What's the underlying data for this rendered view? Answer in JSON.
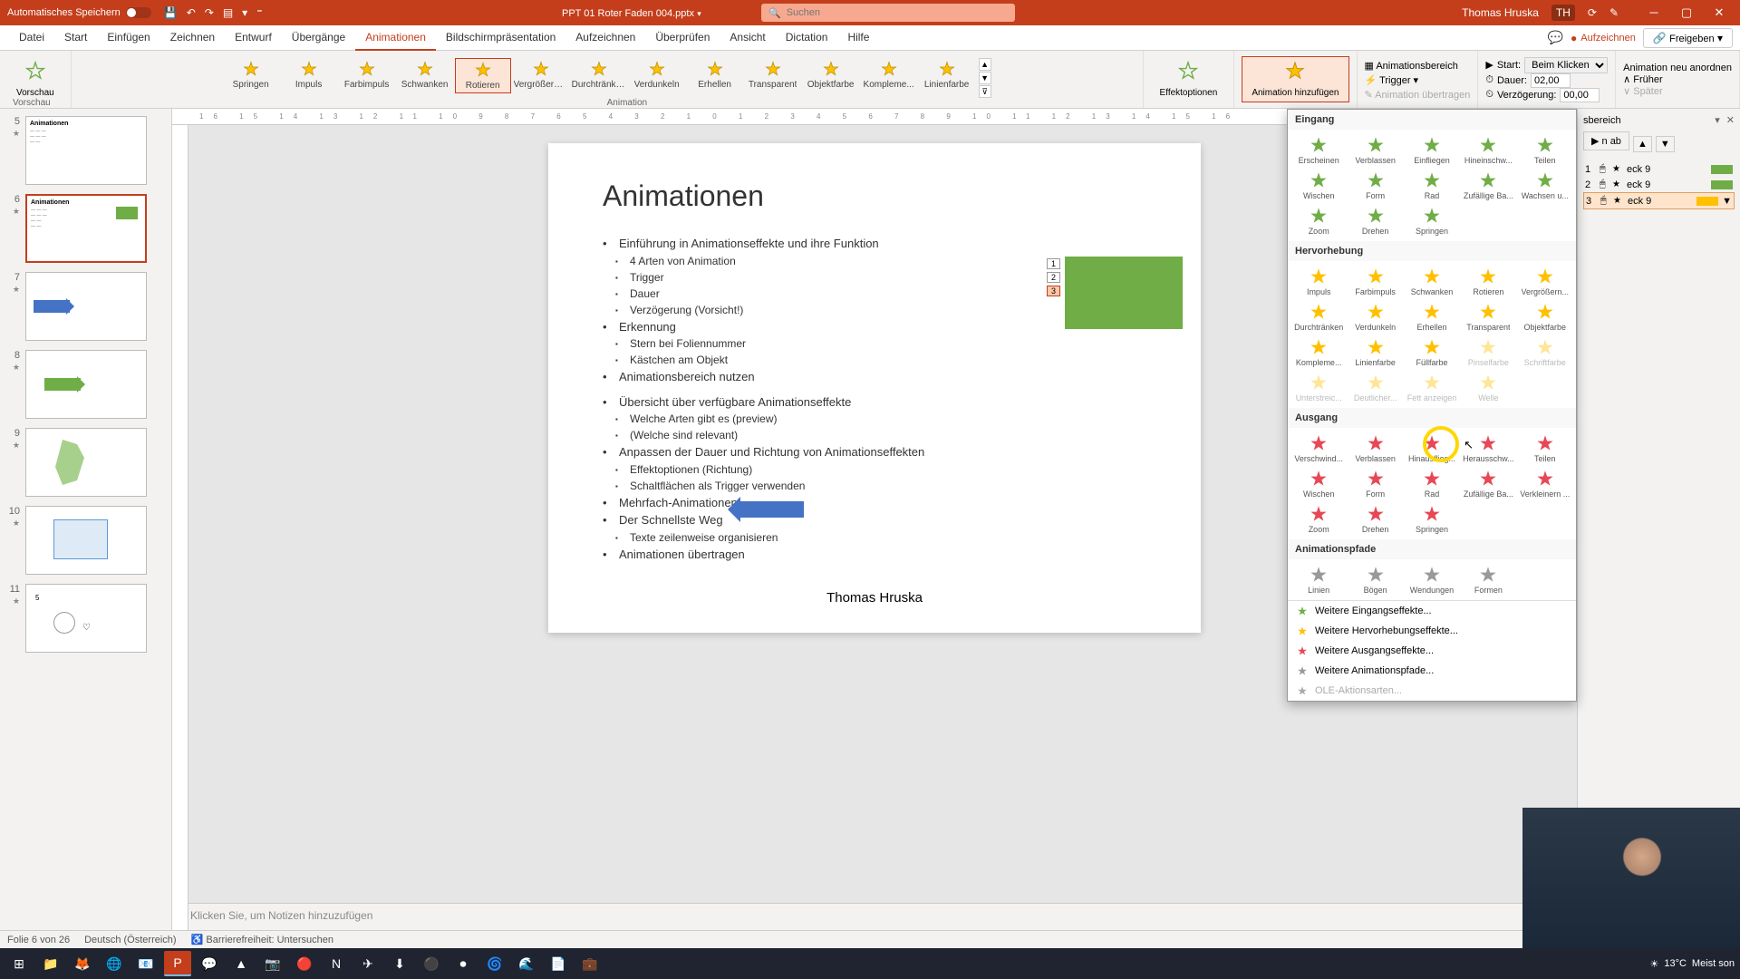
{
  "titlebar": {
    "autosave": "Automatisches Speichern",
    "filename": "PPT 01 Roter Faden 004.pptx",
    "search_placeholder": "Suchen",
    "username": "Thomas Hruska",
    "user_initials": "TH"
  },
  "menubar": {
    "tabs": [
      "Datei",
      "Start",
      "Einfügen",
      "Zeichnen",
      "Entwurf",
      "Übergänge",
      "Animationen",
      "Bildschirmpräsentation",
      "Aufzeichnen",
      "Überprüfen",
      "Ansicht",
      "Dictation",
      "Hilfe"
    ],
    "active": "Animationen",
    "record": "Aufzeichnen",
    "share": "Freigeben"
  },
  "ribbon": {
    "preview_label": "Vorschau",
    "preview_group": "Vorschau",
    "gallery": [
      "Springen",
      "Impuls",
      "Farbimpuls",
      "Schwanken",
      "Rotieren",
      "Vergrößern/...",
      "Durchtränken",
      "Verdunkeln",
      "Erhellen",
      "Transparent",
      "Objektfarbe",
      "Kompleme...",
      "Linienfarbe"
    ],
    "gallery_selected": "Rotieren",
    "animation_group": "Animation",
    "effect_options": "Effektoptionen",
    "add_animation": "Animation hinzufügen",
    "anim_pane": "Animationsbereich",
    "trigger": "Trigger",
    "anim_painter": "Animation übertragen",
    "start_label": "Start:",
    "start_value": "Beim Klicken",
    "duration_label": "Dauer:",
    "duration_value": "02,00",
    "delay_label": "Verzögerung:",
    "delay_value": "00,00",
    "reorder": "Animation neu anordnen",
    "earlier": "Früher",
    "later": "Später"
  },
  "thumbs": [
    {
      "num": "5",
      "title": "Animationen"
    },
    {
      "num": "6",
      "title": "Animationen",
      "active": true
    },
    {
      "num": "7",
      "title": ""
    },
    {
      "num": "8",
      "title": ""
    },
    {
      "num": "9",
      "title": ""
    },
    {
      "num": "10",
      "title": ""
    },
    {
      "num": "11",
      "title": ""
    }
  ],
  "slide": {
    "title": "Animationen",
    "bullets": [
      {
        "t": "Einführung in Animationseffekte und ihre Funktion",
        "sub": [
          "4 Arten von Animation",
          "Trigger",
          "Dauer",
          "Verzögerung (Vorsicht!)"
        ]
      },
      {
        "t": "Erkennung",
        "sub": [
          "Stern bei Foliennummer",
          "Kästchen am Objekt"
        ]
      },
      {
        "t": "Animationsbereich nutzen",
        "sub": []
      },
      {
        "t": "",
        "sub": []
      },
      {
        "t": "Übersicht über verfügbare Animationseffekte",
        "sub": [
          "Welche Arten gibt es (preview)",
          "(Welche sind relevant)"
        ]
      },
      {
        "t": "Anpassen der Dauer und Richtung von Animationseffekten",
        "sub": [
          "Effektoptionen (Richtung)",
          "Schaltflächen als Trigger verwenden"
        ]
      },
      {
        "t": "Mehrfach-Animationen",
        "sub": []
      },
      {
        "t": "Der Schnellste Weg",
        "sub": [
          "Texte zeilenweise organisieren"
        ]
      },
      {
        "t": "Animationen übertragen",
        "sub": []
      }
    ],
    "tags": [
      "1",
      "2",
      "3"
    ],
    "author": "Thomas Hruska"
  },
  "notes": "Klicken Sie, um Notizen hinzuzufügen",
  "anim_panel": {
    "sections": [
      {
        "header": "Eingang",
        "color": "green",
        "items": [
          "Erscheinen",
          "Verblassen",
          "Einfliegen",
          "Hineinschw...",
          "Teilen",
          "Wischen",
          "Form",
          "Rad",
          "Zufällige Ba...",
          "Wachsen u...",
          "Zoom",
          "Drehen",
          "Springen"
        ]
      },
      {
        "header": "Hervorhebung",
        "color": "yellow",
        "items": [
          "Impuls",
          "Farbimpuls",
          "Schwanken",
          "Rotieren",
          "Vergrößern...",
          "Durchtränken",
          "Verdunkeln",
          "Erhellen",
          "Transparent",
          "Objektfarbe",
          "Kompleme...",
          "Linienfarbe",
          "Füllfarbe",
          "Pinselfarbe",
          "Schriftfarbe",
          "Unterstreic...",
          "Deutlicher...",
          "Fett anzeigen",
          "Welle"
        ]
      },
      {
        "header": "Ausgang",
        "color": "red",
        "items": [
          "Verschwind...",
          "Verblassen",
          "Hinausflieg...",
          "Herausschw...",
          "Teilen",
          "Wischen",
          "Form",
          "Rad",
          "Zufällige Ba...",
          "Verkleinern ...",
          "Zoom",
          "Drehen",
          "Springen"
        ]
      },
      {
        "header": "Animationspfade",
        "color": "gray",
        "items": [
          "Linien",
          "Bögen",
          "Wendungen",
          "Formen"
        ]
      }
    ],
    "footer": [
      {
        "t": "Weitere Eingangseffekte...",
        "icon": "green"
      },
      {
        "t": "Weitere Hervorhebungseffekte...",
        "icon": "yellow"
      },
      {
        "t": "Weitere Ausgangseffekte...",
        "icon": "red"
      },
      {
        "t": "Weitere Animationspfade...",
        "icon": "gray"
      },
      {
        "t": "OLE-Aktionsarten...",
        "disabled": true
      }
    ]
  },
  "anim_pane": {
    "title": "sbereich",
    "play": "n ab",
    "items": [
      {
        "idx": "1",
        "name": "eck 9",
        "bar": "#70ad47"
      },
      {
        "idx": "2",
        "name": "eck 9",
        "bar": "#70ad47"
      },
      {
        "idx": "3",
        "name": "eck 9",
        "bar": "#ffc000",
        "selected": true
      }
    ]
  },
  "statusbar": {
    "slide_info": "Folie 6 von 26",
    "language": "Deutsch (Österreich)",
    "accessibility": "Barrierefreiheit: Untersuchen"
  },
  "taskbar": {
    "weather_temp": "13°C",
    "weather_text": "Meist son"
  }
}
